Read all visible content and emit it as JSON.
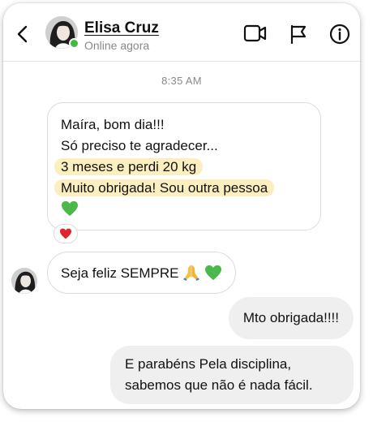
{
  "header": {
    "contact_name": "Elisa Cruz",
    "status": "Online agora",
    "icons": [
      "back-arrow-icon",
      "video-camera-icon",
      "flag-icon",
      "info-icon"
    ]
  },
  "conversation": {
    "timestamp": "8:35 AM",
    "messages": [
      {
        "direction": "incoming",
        "lines": [
          "Maíra, bom dia!!!",
          "Só preciso te agradecer...",
          "3 meses e perdi 20 kg",
          "Muito obrigada! Sou outra pessoa"
        ],
        "highlighted_lines": [
          2,
          3
        ],
        "emoji": "green-heart",
        "reaction": "red-heart"
      },
      {
        "direction": "incoming",
        "text": "Seja feliz SEMPRE",
        "emojis": [
          "folded-hands",
          "green-heart"
        ]
      },
      {
        "direction": "outgoing",
        "text": "Mto obrigada!!!!"
      },
      {
        "direction": "outgoing",
        "lines": [
          "E parabéns Pela disciplina,",
          "sabemos que não é nada fácil."
        ]
      }
    ]
  },
  "colors": {
    "highlight": "#fbefbf",
    "online": "#3fbb3f",
    "outgoing_bubble": "#efefef",
    "incoming_border": "#dcdcdc"
  }
}
